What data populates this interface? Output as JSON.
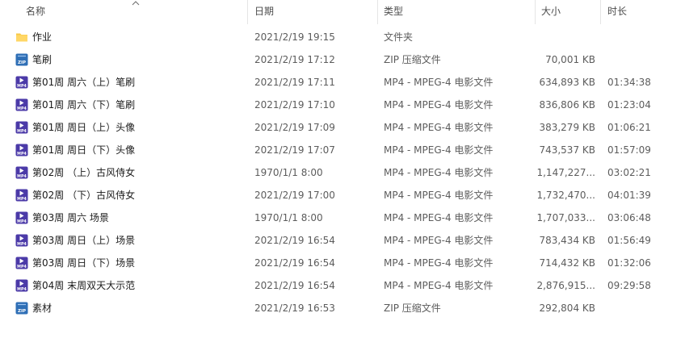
{
  "columns": {
    "name": "名称",
    "date": "日期",
    "type": "类型",
    "size": "大小",
    "duration": "时长"
  },
  "rows": [
    {
      "icon": "folder-icon",
      "name": "作业",
      "date": "2021/2/19 19:15",
      "type": "文件夹",
      "size": "",
      "duration": ""
    },
    {
      "icon": "zip-file-icon",
      "name": "笔刷",
      "date": "2021/2/19 17:12",
      "type": "ZIP 压缩文件",
      "size": "70,001 KB",
      "duration": ""
    },
    {
      "icon": "mp4-file-icon",
      "name": "第01周 周六（上）笔刷",
      "date": "2021/2/19 17:11",
      "type": "MP4 - MPEG-4 电影文件",
      "size": "634,893 KB",
      "duration": "01:34:38"
    },
    {
      "icon": "mp4-file-icon",
      "name": "第01周 周六（下）笔刷",
      "date": "2021/2/19 17:10",
      "type": "MP4 - MPEG-4 电影文件",
      "size": "836,806 KB",
      "duration": "01:23:04"
    },
    {
      "icon": "mp4-file-icon",
      "name": "第01周 周日（上）头像",
      "date": "2021/2/19 17:09",
      "type": "MP4 - MPEG-4 电影文件",
      "size": "383,279 KB",
      "duration": "01:06:21"
    },
    {
      "icon": "mp4-file-icon",
      "name": "第01周 周日（下）头像",
      "date": "2021/2/19 17:07",
      "type": "MP4 - MPEG-4 电影文件",
      "size": "743,537 KB",
      "duration": "01:57:09"
    },
    {
      "icon": "mp4-file-icon",
      "name": "第02周 （上）古风侍女",
      "date": "1970/1/1 8:00",
      "type": "MP4 - MPEG-4 电影文件",
      "size": "1,147,227...",
      "duration": "03:02:21"
    },
    {
      "icon": "mp4-file-icon",
      "name": "第02周 （下）古风侍女",
      "date": "2021/2/19 17:00",
      "type": "MP4 - MPEG-4 电影文件",
      "size": "1,732,470...",
      "duration": "04:01:39"
    },
    {
      "icon": "mp4-file-icon",
      "name": "第03周 周六 场景",
      "date": "1970/1/1 8:00",
      "type": "MP4 - MPEG-4 电影文件",
      "size": "1,707,033...",
      "duration": "03:06:48"
    },
    {
      "icon": "mp4-file-icon",
      "name": "第03周 周日（上）场景",
      "date": "2021/2/19 16:54",
      "type": "MP4 - MPEG-4 电影文件",
      "size": "783,434 KB",
      "duration": "01:56:49"
    },
    {
      "icon": "mp4-file-icon",
      "name": "第03周 周日（下）场景",
      "date": "2021/2/19 16:54",
      "type": "MP4 - MPEG-4 电影文件",
      "size": "714,432 KB",
      "duration": "01:32:06"
    },
    {
      "icon": "mp4-file-icon",
      "name": "第04周 末周双天大示范",
      "date": "2021/2/19 16:54",
      "type": "MP4 - MPEG-4 电影文件",
      "size": "2,876,915...",
      "duration": "09:29:58"
    },
    {
      "icon": "zip-file-icon",
      "name": "素材",
      "date": "2021/2/19 16:53",
      "type": "ZIP 压缩文件",
      "size": "292,804 KB",
      "duration": ""
    }
  ],
  "icons": {
    "zip_badge": "ZIP",
    "mp4_badge": "MP4"
  },
  "colors": {
    "folder": "#f7c948",
    "zip": "#2f6fb6",
    "mp4": "#4b3aa8"
  }
}
